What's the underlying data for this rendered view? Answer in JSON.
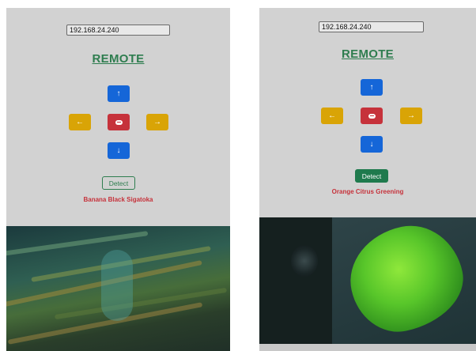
{
  "left": {
    "ip_value": "192.168.24.240",
    "title": "REMOTE",
    "controls": {
      "up": "↑",
      "down": "↓",
      "left": "←",
      "right": "→"
    },
    "detect_label": "Detect",
    "result": "Banana Black Sigatoka"
  },
  "right": {
    "ip_value": "192.168.24.240",
    "title": "REMOTE",
    "controls": {
      "up": "↑",
      "down": "↓",
      "left": "←",
      "right": "→"
    },
    "detect_label": "Detect",
    "result": "Orange Citrus Greening"
  },
  "colors": {
    "background": "#d2d2d2",
    "title_green": "#2e7d4f",
    "blue_button": "#1566d8",
    "yellow_button": "#d9a406",
    "red_button": "#c6323b",
    "result_red": "#c6323b"
  },
  "icons": {
    "up": "arrow-up-icon",
    "down": "arrow-down-icon",
    "left": "arrow-left-icon",
    "right": "arrow-right-icon",
    "stop": "stop-icon"
  }
}
